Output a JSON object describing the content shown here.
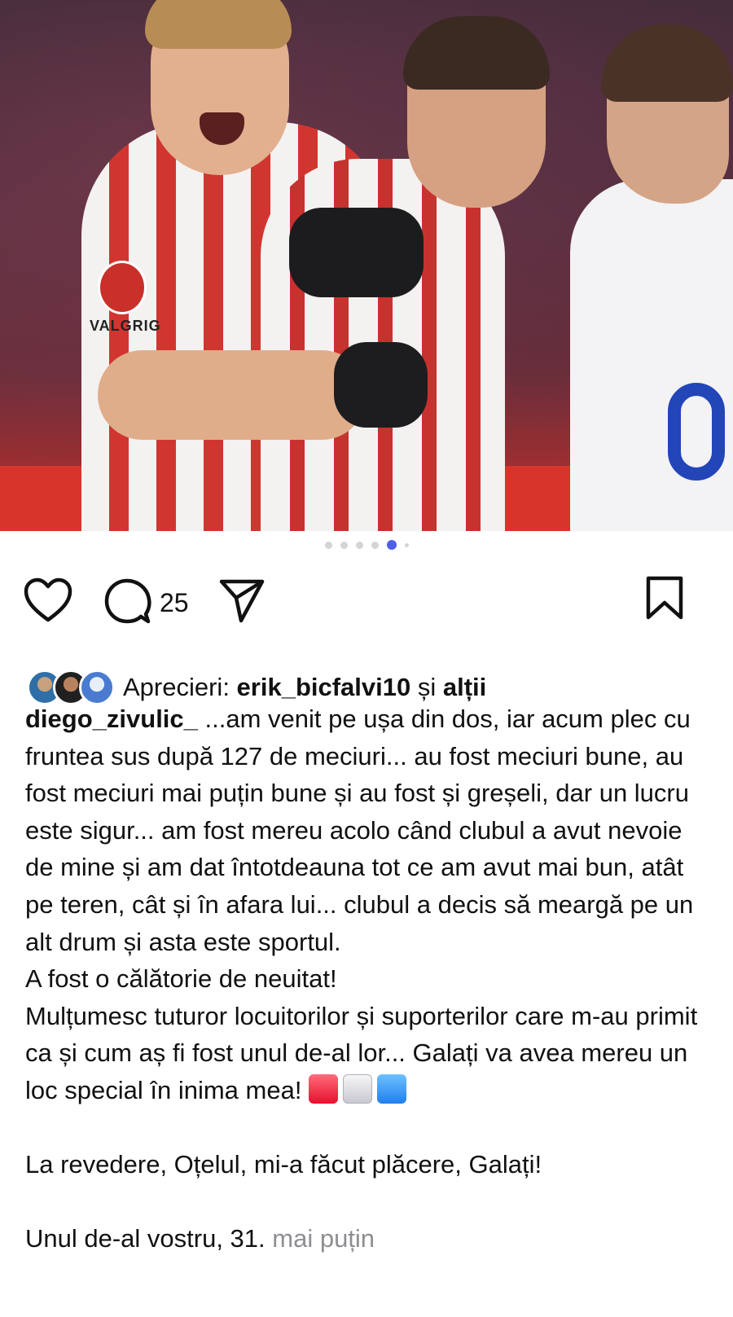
{
  "post": {
    "carousel": {
      "total": 6,
      "active_index": 4,
      "active_color": "#4f5ee8"
    },
    "photo": {
      "sponsor_text": "VALGRIG"
    },
    "actions": {
      "like_icon": "heart-icon",
      "comment_icon": "comment-bubble-icon",
      "comment_count": "25",
      "share_icon": "paper-plane-icon",
      "save_icon": "bookmark-icon"
    },
    "likes": {
      "prefix": "Aprecieri: ",
      "user": "erik_bicfalvi10",
      "connector": " și ",
      "others": "alții"
    },
    "caption": {
      "username": "diego_zivulic_",
      "line1": " ...am venit pe ușa din dos, iar acum plec cu fruntea sus după 127 de meciuri... au fost meciuri bune, au fost meciuri mai puțin bune și au fost și greșeli, dar un lucru este sigur... am fost mereu acolo când clubul a avut nevoie de mine și am dat întotdeauna tot ce am avut mai bun, atât pe teren, cât și în afara lui... clubul a decis să meargă pe un alt drum și asta este sportul.",
      "line2": "A fost o călătorie de neuitat!",
      "line3": "Mulțumesc tuturor locuitorilor și suporterilor care m-au primit ca și cum aș fi fost unul de-al lor... Galați va avea mereu un loc special în inima mea! ",
      "emojis": [
        "red-square",
        "white-square",
        "blue-square"
      ],
      "line4": "La revedere, Oțelul, mi-a făcut plăcere, Galați!",
      "line5": "Unul de-al vostru, 31. ",
      "less_link": "mai puțin"
    }
  }
}
